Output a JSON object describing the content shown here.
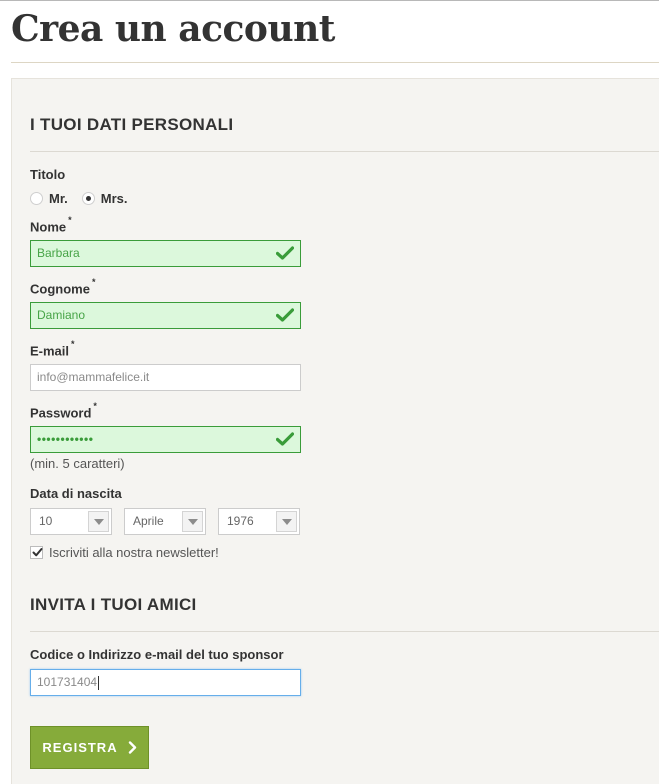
{
  "page": {
    "title": "Crea un account"
  },
  "personal": {
    "heading": "I TUOI DATI PERSONALI",
    "title_label": "Titolo",
    "title_options": [
      "Mr.",
      "Mrs."
    ],
    "title_selected": "Mrs.",
    "first_name_label": "Nome",
    "first_name_value": "Barbara",
    "last_name_label": "Cognome",
    "last_name_value": "Damiano",
    "email_label": "E-mail",
    "email_placeholder": "info@mammafelice.it",
    "password_label": "Password",
    "password_value": "••••••••••••",
    "password_hint": "(min. 5 caratteri)",
    "required_marker": "*",
    "birthdate_label": "Data di nascita",
    "birth_day": "10",
    "birth_month": "Aprile",
    "birth_year": "1976",
    "newsletter_label": "Iscriviti alla nostra newsletter!",
    "newsletter_checked": true
  },
  "invite": {
    "heading": "INVITA I TUOI AMICI",
    "sponsor_label": "Codice o Indirizzo e-mail del tuo sponsor",
    "sponsor_value": "101731404"
  },
  "actions": {
    "submit_label": "REGISTRA"
  },
  "colors": {
    "valid_border": "#3a9c3a",
    "valid_background": "#dcf8dc",
    "submit_background": "#86ab3a",
    "panel_background": "#f5f4f1"
  },
  "icons": {
    "valid_field": "checkmark-icon",
    "select_toggle": "chevron-down-icon",
    "submit": "chevron-right-icon"
  }
}
